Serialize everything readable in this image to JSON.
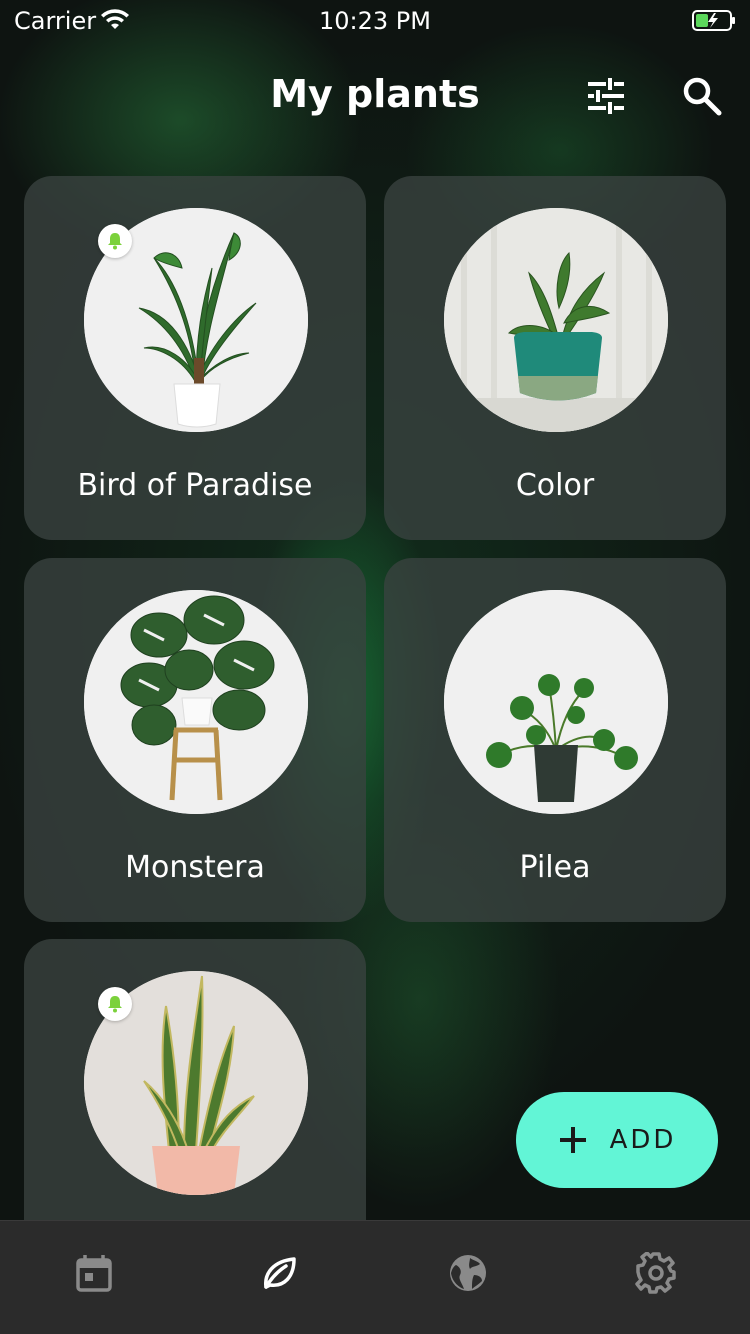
{
  "status_bar": {
    "carrier": "Carrier",
    "time": "10:23 PM"
  },
  "header": {
    "title": "My plants",
    "filter_icon": "sliders-icon",
    "search_icon": "search-icon"
  },
  "plants": [
    {
      "name": "Bird of Paradise",
      "reminder": true
    },
    {
      "name": "Color",
      "reminder": false
    },
    {
      "name": "Monstera",
      "reminder": false
    },
    {
      "name": "Pilea",
      "reminder": false
    },
    {
      "name": "",
      "reminder": true
    }
  ],
  "fab": {
    "label": "ADD",
    "icon": "plus-icon"
  },
  "tab_bar": {
    "items": [
      {
        "icon": "calendar-icon",
        "active": false
      },
      {
        "icon": "leaf-icon",
        "active": true
      },
      {
        "icon": "globe-icon",
        "active": false
      },
      {
        "icon": "gear-icon",
        "active": false
      }
    ]
  },
  "colors": {
    "accent": "#62F5D6",
    "reminder": "#7BD13B",
    "battery": "#5BD75B"
  }
}
